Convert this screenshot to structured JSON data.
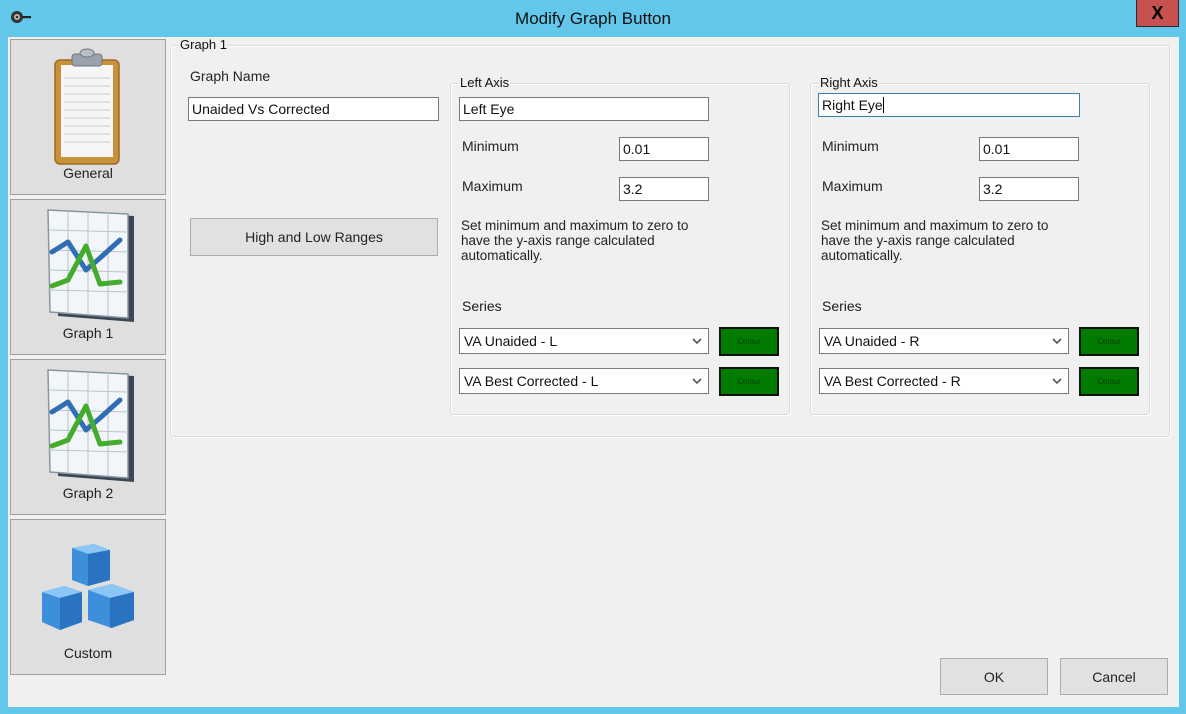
{
  "window": {
    "title": "Modify Graph Button",
    "close_label": "X"
  },
  "sidebar": {
    "items": [
      {
        "label": "General",
        "icon": "clipboard-icon"
      },
      {
        "label": "Graph 1",
        "icon": "line-chart-icon"
      },
      {
        "label": "Graph 2",
        "icon": "line-chart-icon"
      },
      {
        "label": "Custom",
        "icon": "cubes-icon"
      }
    ]
  },
  "graph": {
    "group_title": "Graph 1",
    "name_label": "Graph Name",
    "name_value": "Unaided Vs Corrected",
    "ranges_button": "High and Low Ranges"
  },
  "left_axis": {
    "title": "Left Axis",
    "name_value": "Left Eye",
    "min_label": "Minimum",
    "min_value": "0.01",
    "max_label": "Maximum",
    "max_value": "3.2",
    "help": "Set minimum and maximum to zero to have the y-axis range calculated automatically.",
    "series_label": "Series",
    "series": [
      {
        "value": "VA Unaided - L",
        "colour_label": "Colour",
        "colour": "#007c00"
      },
      {
        "value": "VA Best Corrected - L",
        "colour_label": "Colour",
        "colour": "#007c00"
      }
    ]
  },
  "right_axis": {
    "title": "Right Axis",
    "name_value": "Right Eye",
    "min_label": "Minimum",
    "min_value": "0.01",
    "max_label": "Maximum",
    "max_value": "3.2",
    "help": "Set minimum and maximum to zero to have the y-axis range calculated automatically.",
    "series_label": "Series",
    "series": [
      {
        "value": "VA Unaided - R",
        "colour_label": "Colour",
        "colour": "#007c00"
      },
      {
        "value": "VA Best Corrected - R",
        "colour_label": "Colour",
        "colour": "#007c00"
      }
    ]
  },
  "footer": {
    "ok_label": "OK",
    "cancel_label": "Cancel"
  }
}
